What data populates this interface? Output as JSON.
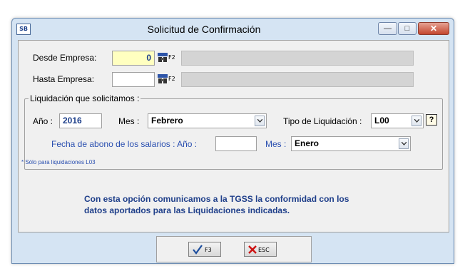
{
  "window": {
    "app_icon_text": "SB",
    "title": "Solicitud de Confirmación",
    "controls": {
      "minimize": "—",
      "maximize": "□",
      "close": "✕"
    }
  },
  "empresa": {
    "desde_label": "Desde Empresa:",
    "desde_value": "0",
    "hasta_label": "Hasta Empresa:",
    "hasta_value": "",
    "lookup_key": "F2"
  },
  "liquidacion": {
    "group_title": "Liquidación que solicitamos :",
    "anio_label": "Año :",
    "anio_value": "2016",
    "mes_label": "Mes :",
    "mes_value": "Febrero",
    "tipo_label": "Tipo de Liquidación :",
    "tipo_value": "L00",
    "help_text": "?",
    "fecha_label": "Fecha de abono de los salarios : Año :",
    "fecha_anio_value": "",
    "fecha_mes_label": "Mes :",
    "fecha_mes_value": "Enero",
    "note": "* Sólo para liquidaciones L03"
  },
  "message": {
    "line1": "Con esta opción comunicamos a la TGSS la conformidad con los",
    "line2": "datos aportados para las Liquidaciones indicadas."
  },
  "footer": {
    "accept_label": "F3",
    "cancel_label": "ESC"
  },
  "colors": {
    "frame": "#d5e4f3",
    "highlight_input": "#ffffc0",
    "blue_text": "#2a4fb0",
    "close_button": "#c4462e"
  }
}
